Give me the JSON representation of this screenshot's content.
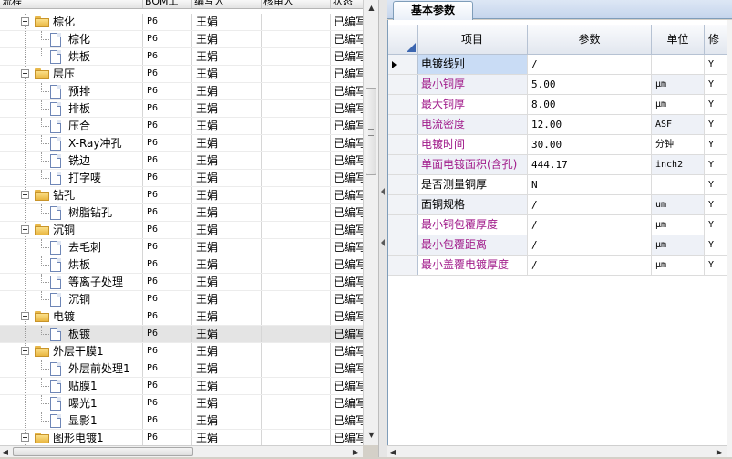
{
  "left_tree": {
    "columns": [
      "流程",
      "BOM工",
      "编写人",
      "核审人",
      "状态"
    ],
    "rows": [
      {
        "name": "棕化",
        "type": "folder",
        "level": 1,
        "bom": "P6",
        "author": "王娟",
        "reviewer": "",
        "status": "已编写"
      },
      {
        "name": "棕化",
        "type": "doc",
        "level": 2,
        "bom": "P6",
        "author": "王娟",
        "reviewer": "",
        "status": "已编写"
      },
      {
        "name": "烘板",
        "type": "doc",
        "level": 2,
        "bom": "P6",
        "author": "王娟",
        "reviewer": "",
        "status": "已编写"
      },
      {
        "name": "层压",
        "type": "folder",
        "level": 1,
        "bom": "P6",
        "author": "王娟",
        "reviewer": "",
        "status": "已编写"
      },
      {
        "name": "预排",
        "type": "doc",
        "level": 2,
        "bom": "P6",
        "author": "王娟",
        "reviewer": "",
        "status": "已编写"
      },
      {
        "name": "排板",
        "type": "doc",
        "level": 2,
        "bom": "P6",
        "author": "王娟",
        "reviewer": "",
        "status": "已编写"
      },
      {
        "name": "压合",
        "type": "doc",
        "level": 2,
        "bom": "P6",
        "author": "王娟",
        "reviewer": "",
        "status": "已编写"
      },
      {
        "name": "X-Ray冲孔",
        "type": "doc",
        "level": 2,
        "bom": "P6",
        "author": "王娟",
        "reviewer": "",
        "status": "已编写"
      },
      {
        "name": "铣边",
        "type": "doc",
        "level": 2,
        "bom": "P6",
        "author": "王娟",
        "reviewer": "",
        "status": "已编写"
      },
      {
        "name": "打字唛",
        "type": "doc",
        "level": 2,
        "bom": "P6",
        "author": "王娟",
        "reviewer": "",
        "status": "已编写"
      },
      {
        "name": "钻孔",
        "type": "folder",
        "level": 1,
        "bom": "P6",
        "author": "王娟",
        "reviewer": "",
        "status": "已编写"
      },
      {
        "name": "树脂钻孔",
        "type": "doc",
        "level": 2,
        "bom": "P6",
        "author": "王娟",
        "reviewer": "",
        "status": "已编写"
      },
      {
        "name": "沉铜",
        "type": "folder",
        "level": 1,
        "bom": "P6",
        "author": "王娟",
        "reviewer": "",
        "status": "已编写"
      },
      {
        "name": "去毛刺",
        "type": "doc",
        "level": 2,
        "bom": "P6",
        "author": "王娟",
        "reviewer": "",
        "status": "已编写"
      },
      {
        "name": "烘板",
        "type": "doc",
        "level": 2,
        "bom": "P6",
        "author": "王娟",
        "reviewer": "",
        "status": "已编写"
      },
      {
        "name": "等离子处理",
        "type": "doc",
        "level": 2,
        "bom": "P6",
        "author": "王娟",
        "reviewer": "",
        "status": "已编写"
      },
      {
        "name": "沉铜",
        "type": "doc",
        "level": 2,
        "bom": "P6",
        "author": "王娟",
        "reviewer": "",
        "status": "已编写"
      },
      {
        "name": "电镀",
        "type": "folder",
        "level": 1,
        "bom": "P6",
        "author": "王娟",
        "reviewer": "",
        "status": "已编写"
      },
      {
        "name": "板镀",
        "type": "doc",
        "level": 2,
        "bom": "P6",
        "author": "王娟",
        "reviewer": "",
        "status": "已编写",
        "selected": true
      },
      {
        "name": "外层干膜1",
        "type": "folder",
        "level": 1,
        "bom": "P6",
        "author": "王娟",
        "reviewer": "",
        "status": "已编写"
      },
      {
        "name": "外层前处理1",
        "type": "doc",
        "level": 2,
        "bom": "P6",
        "author": "王娟",
        "reviewer": "",
        "status": "已编写"
      },
      {
        "name": "贴膜1",
        "type": "doc",
        "level": 2,
        "bom": "P6",
        "author": "王娟",
        "reviewer": "",
        "status": "已编写"
      },
      {
        "name": "曝光1",
        "type": "doc",
        "level": 2,
        "bom": "P6",
        "author": "王娟",
        "reviewer": "",
        "status": "已编写"
      },
      {
        "name": "显影1",
        "type": "doc",
        "level": 2,
        "bom": "P6",
        "author": "王娟",
        "reviewer": "",
        "status": "已编写"
      },
      {
        "name": "图形电镀1",
        "type": "folder",
        "level": 1,
        "bom": "P6",
        "author": "王娟",
        "reviewer": "",
        "status": "已编写"
      }
    ]
  },
  "right_panel": {
    "tab_label": "基本参数",
    "columns": [
      "项目",
      "参数",
      "单位",
      "修"
    ],
    "rows": [
      {
        "item": "电镀线别",
        "value": "/",
        "unit": "",
        "flag": "Y",
        "color": "black",
        "current": true
      },
      {
        "item": "最小铜厚",
        "value": "5.00",
        "unit": "μm",
        "flag": "Y",
        "color": "magenta"
      },
      {
        "item": "最大铜厚",
        "value": "8.00",
        "unit": "μm",
        "flag": "Y",
        "color": "magenta"
      },
      {
        "item": "电流密度",
        "value": "12.00",
        "unit": "ASF",
        "flag": "Y",
        "color": "magenta"
      },
      {
        "item": "电镀时间",
        "value": "30.00",
        "unit": "分钟",
        "flag": "Y",
        "color": "magenta"
      },
      {
        "item": "单面电镀面积(含孔)",
        "value": "444.17",
        "unit": "inch2",
        "flag": "Y",
        "color": "magenta"
      },
      {
        "item": "是否测量铜厚",
        "value": "N",
        "unit": "",
        "flag": "Y",
        "color": "black"
      },
      {
        "item": "面铜规格",
        "value": "/",
        "unit": "um",
        "flag": "Y",
        "color": "black"
      },
      {
        "item": "最小铜包覆厚度",
        "value": "/",
        "unit": "μm",
        "flag": "Y",
        "color": "magenta"
      },
      {
        "item": "最小包覆距离",
        "value": "/",
        "unit": "μm",
        "flag": "Y",
        "color": "magenta"
      },
      {
        "item": "最小盖覆电镀厚度",
        "value": "/",
        "unit": "μm",
        "flag": "Y",
        "color": "magenta"
      }
    ]
  },
  "colors": {
    "magenta_label": "#a01a8a",
    "tab_border": "#7f9db9",
    "folder": "#e9b640"
  }
}
